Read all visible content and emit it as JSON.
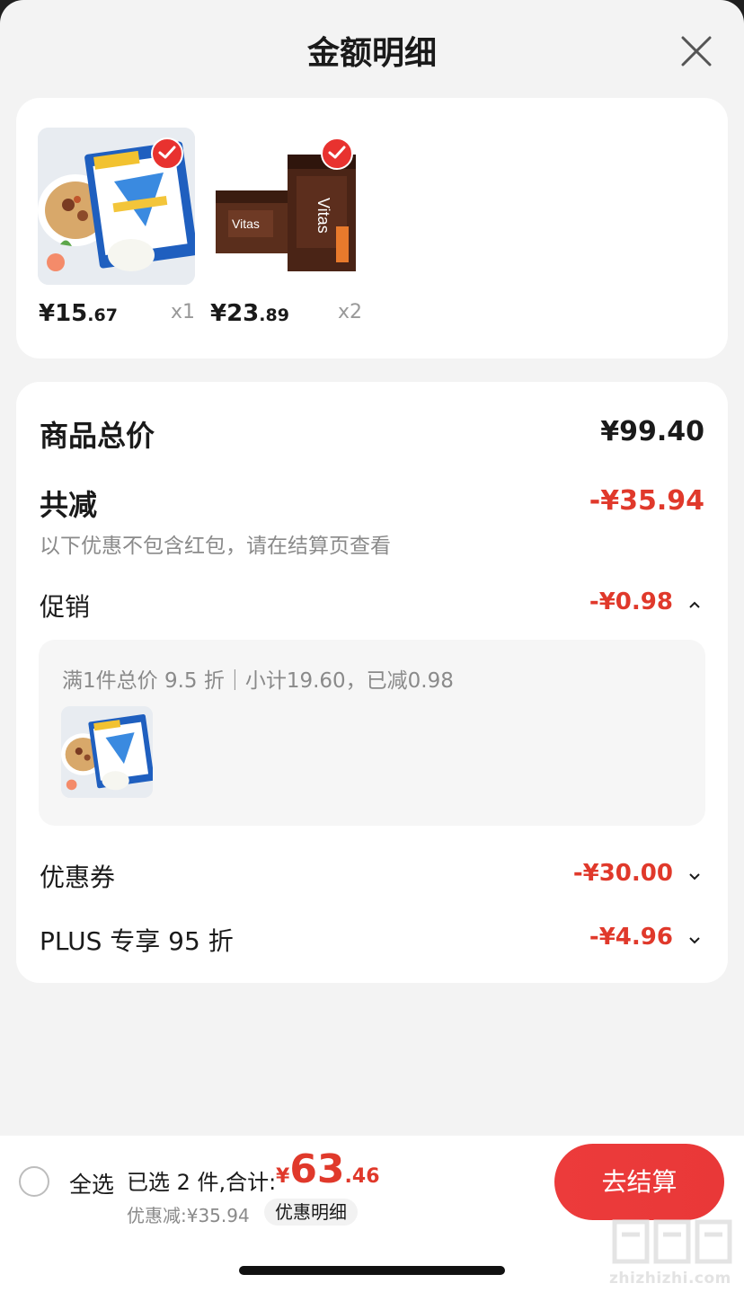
{
  "header": {
    "title": "金额明细",
    "close_icon": "close-icon"
  },
  "products": [
    {
      "price_int": "¥15",
      "price_dec": ".67",
      "qty": "x1",
      "image": "white-fungus-soup-package",
      "checked": true
    },
    {
      "price_int": "¥23",
      "price_dec": ".89",
      "qty": "x2",
      "image": "vitasoy-drink-carton",
      "checked": true
    }
  ],
  "summary": {
    "total_label": "商品总价",
    "total_value": "¥99.40",
    "reduce_label": "共减",
    "reduce_value": "-¥35.94",
    "note": "以下优惠不包含红包，请在结算页查看",
    "promo_label": "促销",
    "promo_value": "-¥0.98",
    "promo_detail": "满1件总价 9.5 折｜小计19.60，已减0.98",
    "coupon_label": "优惠券",
    "coupon_value": "-¥30.00",
    "plus_label": "PLUS 专享 95 折",
    "plus_value": "-¥4.96"
  },
  "footer": {
    "select_all": "全选",
    "selected_text": "已选 2 件,合计:",
    "total_yen": "¥",
    "total_int": "63",
    "total_dec": ".46",
    "discount_text": "优惠减:¥35.94",
    "detail_chip": "优惠明细",
    "checkout_label": "去结算"
  },
  "watermark": {
    "text": "zhizhizhi.com"
  },
  "colors": {
    "accent_red": "#e0392b",
    "checkout_red": "#ec3b3b",
    "background": "#f3f3f3"
  }
}
